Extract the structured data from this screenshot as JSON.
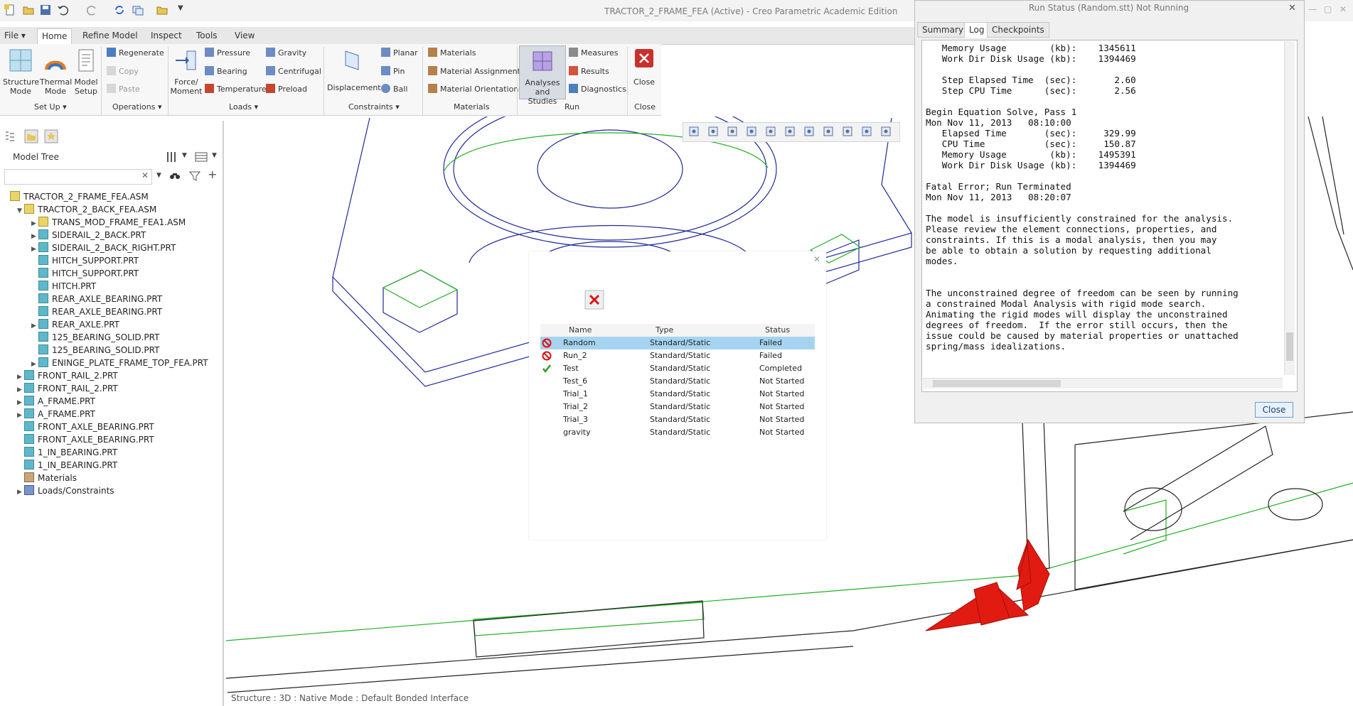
{
  "app": {
    "title": "TRACTOR_2_FRAME_FEA (Active) - Creo Parametric Academic Edition"
  },
  "ribbon": {
    "tabs": [
      "File",
      "Home",
      "Refine Model",
      "Inspect",
      "Tools",
      "View"
    ],
    "groups": {
      "setup": "Set Up",
      "operations": "Operations",
      "loads": "Loads",
      "constraints": "Constraints",
      "materials": "Materials",
      "run": "Run",
      "close": "Close"
    },
    "buttons": {
      "structure_mode": [
        "Structure",
        "Mode"
      ],
      "thermal_mode": [
        "Thermal",
        "Mode"
      ],
      "model_setup": [
        "Model",
        "Setup"
      ],
      "regenerate": "Regenerate",
      "copy": "Copy",
      "paste": "Paste",
      "force_moment": [
        "Force/",
        "Moment"
      ],
      "pressure": "Pressure",
      "bearing": "Bearing",
      "temperature": "Temperature",
      "gravity": "Gravity",
      "centrifugal": "Centrifugal",
      "preload": "Preload",
      "displacement": "Displacement",
      "planar": "Planar",
      "pin": "Pin",
      "ball": "Ball",
      "materials": "Materials",
      "material_assignment": "Material Assignment",
      "material_orientations": "Material Orientations",
      "analyses": [
        "Analyses",
        "and Studies"
      ],
      "measures": "Measures",
      "results": "Results",
      "diagnostics": "Diagnostics",
      "close": "Close"
    }
  },
  "model_tree": {
    "title": "Model Tree",
    "items": [
      {
        "label": "TRACTOR_2_FRAME_FEA.ASM",
        "type": "asm",
        "indent": 0,
        "expand": ""
      },
      {
        "label": "TRACTOR_2_BACK_FEA.ASM",
        "type": "asm",
        "indent": 1,
        "expand": "▼"
      },
      {
        "label": "TRANS_MOD_FRAME_FEA1.ASM",
        "type": "asm",
        "indent": 2,
        "expand": "▶"
      },
      {
        "label": "SIDERAIL_2_BACK.PRT",
        "type": "prt",
        "indent": 2,
        "expand": "▶"
      },
      {
        "label": "SIDERAIL_2_BACK_RIGHT.PRT",
        "type": "prt",
        "indent": 2,
        "expand": "▶"
      },
      {
        "label": "HITCH_SUPPORT.PRT",
        "type": "prt",
        "indent": 2,
        "expand": ""
      },
      {
        "label": "HITCH_SUPPORT.PRT",
        "type": "prt",
        "indent": 2,
        "expand": ""
      },
      {
        "label": "HITCH.PRT",
        "type": "prt",
        "indent": 2,
        "expand": ""
      },
      {
        "label": "REAR_AXLE_BEARING.PRT",
        "type": "prt",
        "indent": 2,
        "expand": ""
      },
      {
        "label": "REAR_AXLE_BEARING.PRT",
        "type": "prt",
        "indent": 2,
        "expand": ""
      },
      {
        "label": "REAR_AXLE.PRT",
        "type": "prt",
        "indent": 2,
        "expand": "▶"
      },
      {
        "label": "125_BEARING_SOLID.PRT",
        "type": "prt",
        "indent": 2,
        "expand": ""
      },
      {
        "label": "125_BEARING_SOLID.PRT",
        "type": "prt",
        "indent": 2,
        "expand": ""
      },
      {
        "label": "ENINGE_PLATE_FRAME_TOP_FEA.PRT",
        "type": "prt",
        "indent": 2,
        "expand": "▶"
      },
      {
        "label": "FRONT_RAIL_2.PRT",
        "type": "prt",
        "indent": 1,
        "expand": "▶"
      },
      {
        "label": "FRONT_RAIL_2.PRT",
        "type": "prt",
        "indent": 1,
        "expand": "▶"
      },
      {
        "label": "A_FRAME.PRT",
        "type": "prt",
        "indent": 1,
        "expand": "▶"
      },
      {
        "label": "A_FRAME.PRT",
        "type": "prt",
        "indent": 1,
        "expand": "▶"
      },
      {
        "label": "FRONT_AXLE_BEARING.PRT",
        "type": "prt",
        "indent": 1,
        "expand": ""
      },
      {
        "label": "FRONT_AXLE_BEARING.PRT",
        "type": "prt",
        "indent": 1,
        "expand": ""
      },
      {
        "label": "1_IN_BEARING.PRT",
        "type": "prt",
        "indent": 1,
        "expand": ""
      },
      {
        "label": "1_IN_BEARING.PRT",
        "type": "prt",
        "indent": 1,
        "expand": ""
      },
      {
        "label": "Materials",
        "type": "mat",
        "indent": 1,
        "expand": ""
      },
      {
        "label": "Loads/Constraints",
        "type": "load",
        "indent": 1,
        "expand": "▶"
      }
    ]
  },
  "studies": {
    "columns": [
      "Name",
      "Type",
      "Status"
    ],
    "rows": [
      {
        "name": "Random",
        "type": "Standard/Static",
        "status": "Failed",
        "icon": "failed",
        "selected": true
      },
      {
        "name": "Run_2",
        "type": "Standard/Static",
        "status": "Failed",
        "icon": "failed",
        "selected": false
      },
      {
        "name": "Test",
        "type": "Standard/Static",
        "status": "Completed",
        "icon": "ok",
        "selected": false
      },
      {
        "name": "Test_6",
        "type": "Standard/Static",
        "status": "Not Started",
        "icon": "",
        "selected": false
      },
      {
        "name": "Trial_1",
        "type": "Standard/Static",
        "status": "Not Started",
        "icon": "",
        "selected": false
      },
      {
        "name": "Trial_2",
        "type": "Standard/Static",
        "status": "Not Started",
        "icon": "",
        "selected": false
      },
      {
        "name": "Trial_3",
        "type": "Standard/Static",
        "status": "Not Started",
        "icon": "",
        "selected": false
      },
      {
        "name": "gravity",
        "type": "Standard/Static",
        "status": "Not Started",
        "icon": "",
        "selected": false
      }
    ]
  },
  "run_status": {
    "title": "Run Status (Random.stt) Not Running",
    "tabs": [
      "Summary",
      "Log",
      "Checkpoints"
    ],
    "log": "   Memory Usage        (kb):    1345611\n   Work Dir Disk Usage (kb):    1394469\n\n   Step Elapsed Time  (sec):       2.60\n   Step CPU Time      (sec):       2.56\n\nBegin Equation Solve, Pass 1\nMon Nov 11, 2013   08:10:00\n   Elapsed Time       (sec):     329.99\n   CPU Time           (sec):     150.87\n   Memory Usage        (kb):    1495391\n   Work Dir Disk Usage (kb):    1394469\n\nFatal Error; Run Terminated\nMon Nov 11, 2013   08:20:07\n\nThe model is insufficiently constrained for the analysis.\nPlease review the element connections, properties, and\nconstraints. If this is a modal analysis, then you may\nbe able to obtain a solution by requesting additional\nmodes.\n\n\nThe unconstrained degree of freedom can be seen by running\na constrained Modal Analysis with rigid mode search.\nAnimating the rigid modes will display the unconstrained\ndegrees of freedom.  If the error still occurs, then the\nissue could be caused by material properties or unattached\nspring/mass idealizations.",
    "close_label": "Close"
  },
  "status_bar": {
    "text": "Structure : 3D : Native Mode : Default Bonded Interface"
  }
}
